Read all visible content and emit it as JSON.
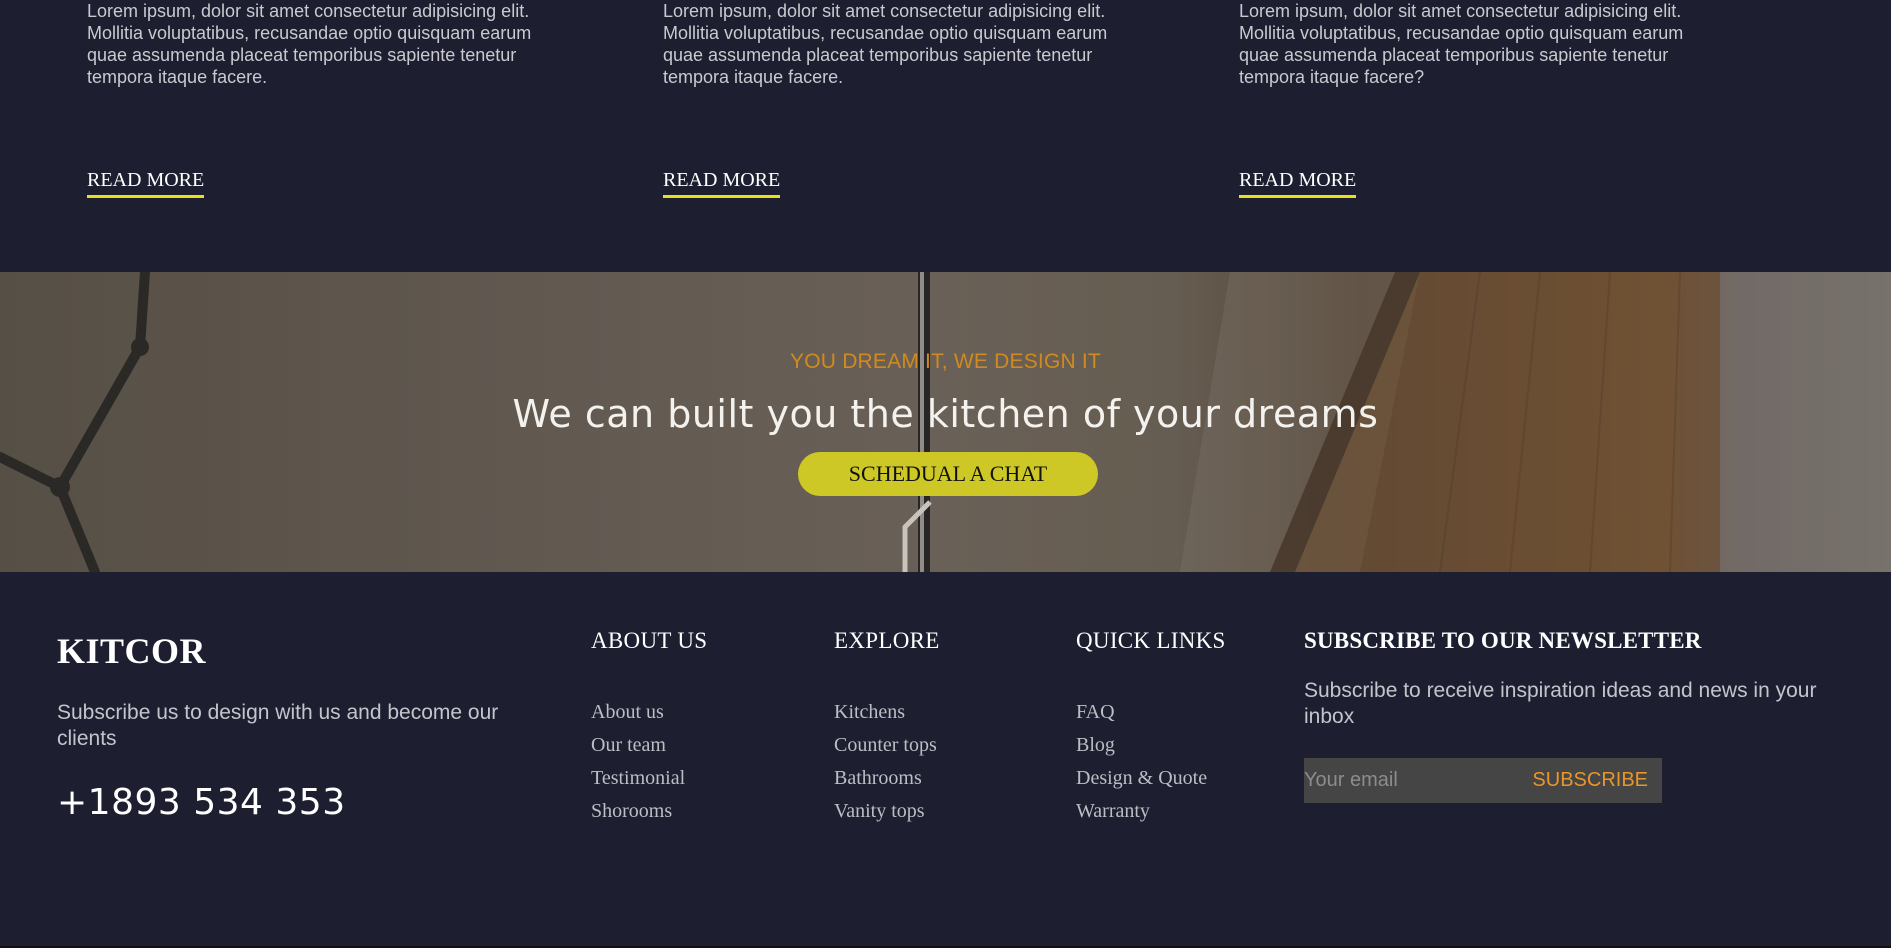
{
  "cards": [
    {
      "text": "Lorem ipsum, dolor sit amet consectetur adipisicing elit. Mollitia voluptatibus, recusandae optio quisquam earum quae assumenda placeat temporibus sapiente tenetur tempora itaque facere.",
      "link": "READ MORE"
    },
    {
      "text": "Lorem ipsum, dolor sit amet consectetur adipisicing elit. Mollitia voluptatibus, recusandae optio quisquam earum quae assumenda placeat temporibus sapiente tenetur tempora itaque facere.",
      "link": "READ MORE"
    },
    {
      "text": "Lorem ipsum, dolor sit amet consectetur adipisicing elit. Mollitia voluptatibus, recusandae optio quisquam earum quae assumenda placeat temporibus sapiente tenetur tempora itaque facere?",
      "link": "READ MORE"
    }
  ],
  "hero": {
    "subtitle": "YOU DREAM IT, WE DESIGN IT",
    "headline": "We can built you the kitchen of your dreams",
    "cta": "SCHEDUAL A CHAT"
  },
  "footer": {
    "brand": "KITCOR",
    "description": "Subscribe us to design with us and become our clients",
    "phone": "+1893 534 353",
    "columns": [
      {
        "title": "ABOUT US",
        "links": [
          "About us",
          "Our team",
          "Testimonial",
          "Shorooms"
        ]
      },
      {
        "title": "EXPLORE",
        "links": [
          "Kitchens",
          "Counter tops",
          "Bathrooms",
          "Vanity tops"
        ]
      },
      {
        "title": "QUICK LINKS",
        "links": [
          "FAQ",
          "Blog",
          "Design & Quote",
          "Warranty"
        ]
      }
    ],
    "newsletter": {
      "title": "SUBSCRIBE TO OUR NEWSLETTER",
      "text": "Subscribe to receive inspiration ideas and news in your inbox",
      "placeholder": "Your email",
      "button": "SUBSCRIBE"
    }
  },
  "colors": {
    "background": "#1d1f30",
    "accent_yellow": "#cdc826",
    "accent_orange": "#e8962a",
    "link_underline": "#e8e01a"
  }
}
